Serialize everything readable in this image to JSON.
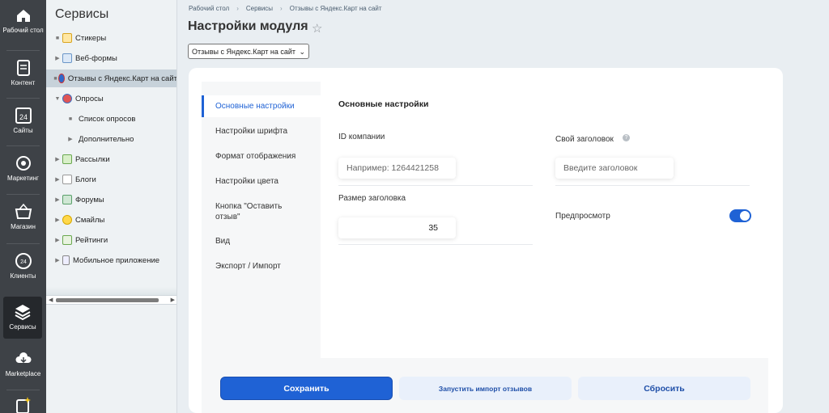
{
  "rail": {
    "items": [
      {
        "label": "Рабочий стол",
        "icon": "home-icon"
      },
      {
        "label": "Контент",
        "icon": "document-icon"
      },
      {
        "label": "Сайты",
        "icon": "calendar-24-icon"
      },
      {
        "label": "Маркетинг",
        "icon": "target-icon"
      },
      {
        "label": "Магазин",
        "icon": "basket-icon"
      },
      {
        "label": "Клиенты",
        "icon": "clients-24-icon"
      },
      {
        "label": "Сервисы",
        "icon": "layers-icon"
      },
      {
        "label": "Marketplace",
        "icon": "cloud-download-icon"
      },
      {
        "label": "",
        "icon": "magic-wand-icon"
      }
    ]
  },
  "menu": {
    "title": "Сервисы",
    "items": [
      {
        "label": "Стикеры",
        "marker": "■"
      },
      {
        "label": "Веб-формы",
        "marker": "▶"
      },
      {
        "label": "Отзывы с Яндекс.Карт на сайт",
        "marker": "■"
      },
      {
        "label": "Опросы",
        "marker": "▼"
      },
      {
        "label": "Список опросов",
        "marker": "■"
      },
      {
        "label": "Дополнительно",
        "marker": "▶"
      },
      {
        "label": "Рассылки",
        "marker": "▶"
      },
      {
        "label": "Блоги",
        "marker": "▶"
      },
      {
        "label": "Форумы",
        "marker": "▶"
      },
      {
        "label": "Смайлы",
        "marker": "▶"
      },
      {
        "label": "Рейтинги",
        "marker": "▶"
      },
      {
        "label": "Мобильное приложение",
        "marker": "▶"
      }
    ]
  },
  "breadcrumbs": [
    "Рабочий стол",
    "Сервисы",
    "Отзывы с Яндекс.Карт на сайт"
  ],
  "breadcrumb_sep": "›",
  "page_title": "Настройки модуля",
  "star": "☆",
  "site_select": {
    "value": "Отзывы с Яндекс.Карт на сайт",
    "arrow": "⌄"
  },
  "tabs": [
    {
      "label": "Основные настройки",
      "active": true
    },
    {
      "label": "Настройки шрифта"
    },
    {
      "label": "Формат отображения"
    },
    {
      "label": "Настройки цвета"
    },
    {
      "label": "Кнопка \"Оставить отзыв\""
    },
    {
      "label": "Вид"
    },
    {
      "label": "Экспорт / Импорт"
    }
  ],
  "form": {
    "section_title": "Основные настройки",
    "company_id": {
      "label": "ID компании",
      "placeholder": "Например: 1264421258",
      "value": ""
    },
    "header_size": {
      "label": "Размер заголовка",
      "value": "35"
    },
    "custom_header": {
      "label": "Свой заголовок",
      "help": "?",
      "placeholder": "Введите заголовок",
      "value": ""
    },
    "preview": {
      "label": "Предпросмотр",
      "enabled": true
    }
  },
  "buttons": {
    "save": "Сохранить",
    "import": "Запустить импорт отзывов",
    "reset": "Сбросить"
  },
  "colors": {
    "accent": "#1f62d5",
    "rail_bg": "#3e4247"
  }
}
